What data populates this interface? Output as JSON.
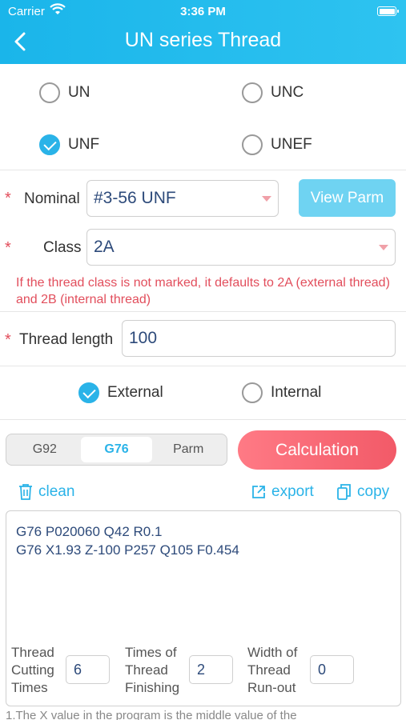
{
  "status": {
    "carrier": "Carrier",
    "time": "3:36 PM"
  },
  "header": {
    "title": "UN series Thread"
  },
  "series": [
    {
      "label": "UN",
      "checked": false
    },
    {
      "label": "UNC",
      "checked": false
    },
    {
      "label": "UNF",
      "checked": true
    },
    {
      "label": "UNEF",
      "checked": false
    }
  ],
  "form": {
    "nominal_label": "Nominal",
    "nominal_value": "#3-56 UNF",
    "view_parm": "View Parm",
    "class_label": "Class",
    "class_value": "2A",
    "hint": "If the thread class is not marked, it defaults to 2A (external thread) and 2B (internal thread)",
    "length_label": "Thread length",
    "length_value": "100",
    "star": "*"
  },
  "thread_type": [
    {
      "label": "External",
      "checked": true
    },
    {
      "label": "Internal",
      "checked": false
    }
  ],
  "tabs": [
    {
      "label": "G92",
      "active": false
    },
    {
      "label": "G76",
      "active": true
    },
    {
      "label": "Parm",
      "active": false
    }
  ],
  "calculation": "Calculation",
  "actions": {
    "clean": "clean",
    "export": "export",
    "copy": "copy"
  },
  "code": {
    "line1": "G76 P020060 Q42 R0.1",
    "line2": "G76 X1.93 Z-100 P257 Q105 F0.454"
  },
  "params": {
    "cutting_l1": "Thread",
    "cutting_l2": "Cutting",
    "cutting_l3": "Times",
    "cutting_value": "6",
    "finishing_l1": "Times of",
    "finishing_l2": "Thread",
    "finishing_l3": "Finishing",
    "finishing_value": "2",
    "runout_l1": "Width of",
    "runout_l2": "Thread",
    "runout_l3": "Run-out",
    "runout_value": "0"
  },
  "footnote": "1.The X value in the program is the middle value of the",
  "colors": {
    "accent": "#2ab3e8",
    "danger": "#e24e5c",
    "header": "#1ab5ea"
  },
  "icons": [
    "wifi-icon",
    "battery-icon",
    "back-arrow-icon",
    "trash-icon",
    "export-icon",
    "copy-icon"
  ]
}
